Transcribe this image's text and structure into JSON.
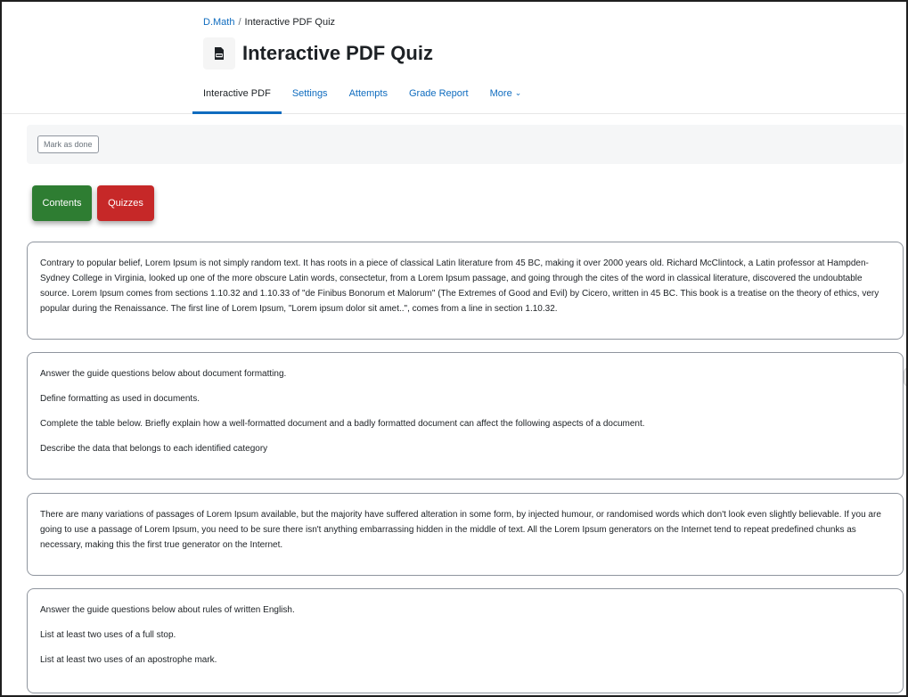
{
  "breadcrumb": {
    "course": "D.Math",
    "separator": "/",
    "current": "Interactive PDF Quiz"
  },
  "page": {
    "title": "Interactive PDF Quiz",
    "icon": "pdf-file-icon"
  },
  "tabs": [
    {
      "label": "Interactive PDF",
      "active": true
    },
    {
      "label": "Settings",
      "active": false
    },
    {
      "label": "Attempts",
      "active": false
    },
    {
      "label": "Grade Report",
      "active": false
    },
    {
      "label": "More",
      "active": false
    }
  ],
  "completion": {
    "mark_done_label": "Mark as done"
  },
  "buttons": {
    "contents_label": "Contents",
    "contents_color": "#2e7d32",
    "quizzes_label": "Quizzes",
    "quizzes_color": "#c62828"
  },
  "cards": [
    {
      "paragraphs": [
        "Contrary to popular belief, Lorem Ipsum is not simply random text. It has roots in a piece of classical Latin literature from 45 BC, making it over 2000 years old. Richard McClintock, a Latin professor at Hampden-Sydney College in Virginia, looked up one of the more obscure Latin words, consectetur, from a Lorem Ipsum passage, and going through the cites of the word in classical literature, discovered the undoubtable source. Lorem Ipsum comes from sections 1.10.32 and 1.10.33 of \"de Finibus Bonorum et Malorum\" (The Extremes of Good and Evil) by Cicero, written in 45 BC. This book is a treatise on the theory of ethics, very popular during the Renaissance. The first line of Lorem Ipsum, \"Lorem ipsum dolor sit amet..\", comes from a line in section 1.10.32."
      ]
    },
    {
      "paragraphs": [
        "Answer the guide questions below about document formatting.",
        "Define formatting as used in documents.",
        "Complete the table below. Briefly explain how a well-formatted document and a badly formatted document can affect the following aspects of a document.",
        "Describe the data that belongs to each identified category"
      ]
    },
    {
      "paragraphs": [
        "There are many variations of passages of Lorem Ipsum available, but the majority have suffered alteration in some form, by injected humour, or randomised words which don't look even slightly believable. If you are going to use a passage of Lorem Ipsum, you need to be sure there isn't anything embarrassing hidden in the middle of text. All the Lorem Ipsum generators on the Internet tend to repeat predefined chunks as necessary, making this the first true generator on the Internet."
      ]
    },
    {
      "paragraphs": [
        "Answer the guide questions below about rules of written English.",
        "List at least two uses of a full stop.",
        "List at least two uses of an apostrophe mark."
      ]
    }
  ],
  "colors": {
    "link": "#0f6cbf",
    "text": "#1d2125",
    "active_tab_underline": "#0f6cbf"
  }
}
